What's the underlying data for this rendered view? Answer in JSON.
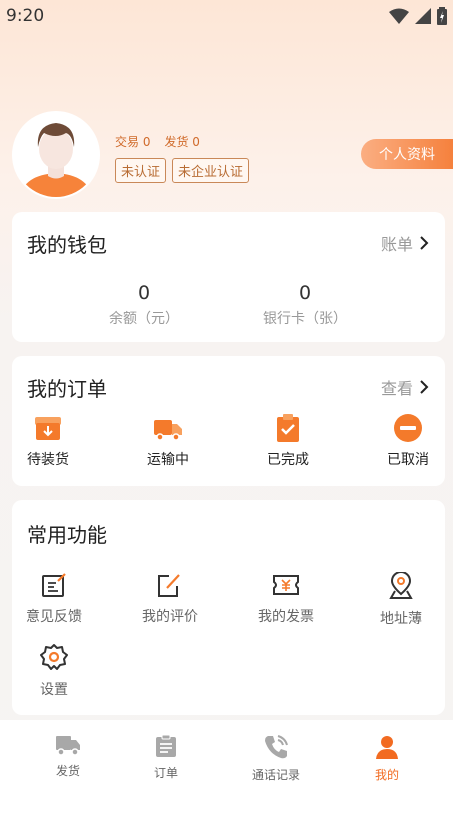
{
  "status_bar": {
    "time": "9:20"
  },
  "profile": {
    "trade_label": "交易 0",
    "ship_label": "发货 0",
    "badge_unverified": "未认证",
    "badge_company_unverified": "未企业认证",
    "profile_button": "个人资料"
  },
  "wallet": {
    "title": "我的钱包",
    "link": "账单",
    "balance_value": "0",
    "balance_label": "余额（元）",
    "cards_value": "0",
    "cards_label": "银行卡（张）"
  },
  "orders": {
    "title": "我的订单",
    "link": "查看",
    "items": [
      {
        "label": "待装货",
        "icon": "box-download-icon"
      },
      {
        "label": "运输中",
        "icon": "truck-icon"
      },
      {
        "label": "已完成",
        "icon": "clipboard-check-icon"
      },
      {
        "label": "已取消",
        "icon": "minus-circle-icon"
      }
    ]
  },
  "functions": {
    "title": "常用功能",
    "items": [
      {
        "label": "意见反馈",
        "icon": "feedback-icon"
      },
      {
        "label": "我的评价",
        "icon": "edit-icon"
      },
      {
        "label": "我的发票",
        "icon": "invoice-icon"
      },
      {
        "label": "地址薄",
        "icon": "location-icon"
      },
      {
        "label": "设置",
        "icon": "settings-icon"
      }
    ]
  },
  "tabbar": {
    "items": [
      {
        "label": "发货",
        "icon": "truck-icon"
      },
      {
        "label": "订单",
        "icon": "list-icon"
      },
      {
        "label": "通话记录",
        "icon": "phone-icon"
      },
      {
        "label": "我的",
        "icon": "user-icon"
      }
    ]
  },
  "colors": {
    "accent": "#f26b21",
    "badge_text": "#b86c33"
  }
}
